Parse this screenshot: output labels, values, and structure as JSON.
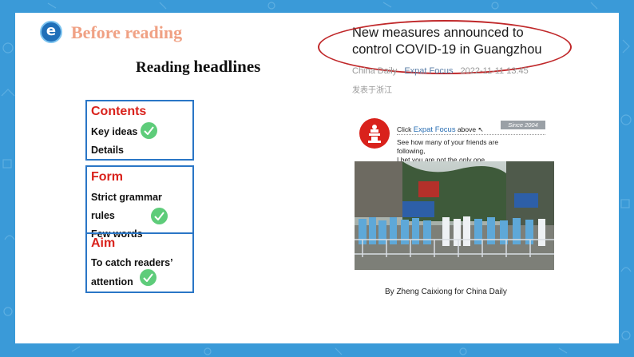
{
  "header": {
    "logo_letter": "e",
    "section_title": "Before reading",
    "subheading_a": "Reading ",
    "subheading_b": "headlines"
  },
  "cards": {
    "contents": {
      "title": "Contents",
      "line1": "Key  ideas",
      "line2": "Details"
    },
    "form": {
      "title": "Form",
      "line1": "Strict grammar",
      "line2": "rules",
      "line3": "Few words"
    },
    "aim": {
      "title": "Aim",
      "line1": "To catch readers’",
      "line2": "attention"
    }
  },
  "article": {
    "headline_line1": "New measures announced to",
    "headline_line2": "control COVID-19 in Guangzhou",
    "source": "China Daily",
    "column": "Expat Focus",
    "datetime": "2022-11-11 13:45",
    "location": "发表于浙江",
    "promo": {
      "click_prefix": "Click ",
      "click_link": "Expat Focus",
      "click_suffix": " above ↖",
      "since": "Since 2004",
      "line1": "See how many of your friends are",
      "line2": "following,",
      "line3": "I bet you are not the only one."
    },
    "caption": "By Zheng Caixiong for China Daily"
  },
  "colors": {
    "background": "#3a9ad8",
    "section_title": "#f0a184",
    "card_border": "#2a76c6",
    "card_title": "#d9221c",
    "check": "#5ecc7a",
    "highlight_ellipse": "#c0282a"
  }
}
